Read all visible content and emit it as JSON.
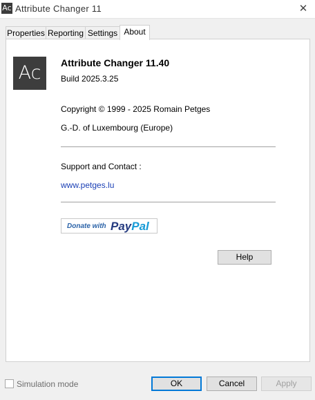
{
  "window": {
    "icon_text": "Ac",
    "title": "Attribute Changer 11",
    "close_glyph": "✕"
  },
  "tabs": [
    {
      "label": "Properties"
    },
    {
      "label": "Reporting"
    },
    {
      "label": "Settings"
    },
    {
      "label": "About",
      "active": true
    }
  ],
  "about": {
    "logo_text": "Ac",
    "product_name": "Attribute Changer 11.40",
    "build": "Build 2025.3.25",
    "copyright": "Copyright © 1999 - 2025 Romain Petges",
    "country": "G.-D. of Luxembourg (Europe)",
    "support_label": "Support and Contact :",
    "website": "www.petges.lu",
    "donate_text": "Donate with",
    "paypal_text_1": "Pay",
    "paypal_text_2": "Pal",
    "help_label": "Help"
  },
  "footer": {
    "simulation_label": "Simulation mode",
    "simulation_checked": false,
    "ok_label": "OK",
    "cancel_label": "Cancel",
    "apply_label": "Apply"
  },
  "colors": {
    "link": "#1a3fb5",
    "paypal_dark": "#253b80",
    "paypal_light": "#179bd7",
    "focus_border": "#0078d7"
  }
}
